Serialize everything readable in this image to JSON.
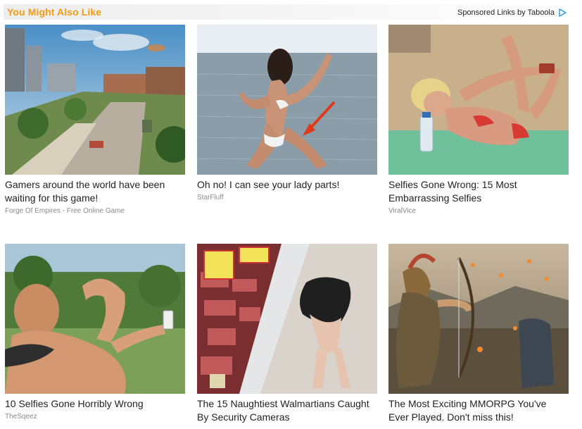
{
  "header": {
    "title": "You Might Also Like",
    "sponsor_label": "Sponsored Links by Taboola",
    "sponsor_icon": "taboola-play-icon"
  },
  "colors": {
    "title_orange": "#f39c12",
    "text": "#222222",
    "source_gray": "#8a8a8a",
    "sponsor_icon_blue": "#3aa7e0"
  },
  "cards": [
    {
      "title": "Gamers around the world have been waiting for this game!",
      "source": "Forge Of Empires - Free Online Game",
      "image": "city-game-scene"
    },
    {
      "title": "Oh no! I can see your lady parts!",
      "source": "StarFluff",
      "image": "beach-runner-photo"
    },
    {
      "title": "Selfies Gone Wrong: 15 Most Embarrassing Selfies",
      "source": "ViralVice",
      "image": "beach-selfie-photo"
    },
    {
      "title": "10 Selfies Gone Horribly Wrong",
      "source": "TheSqeez",
      "image": "outdoor-selfie-photo"
    },
    {
      "title": "The 15 Naughtiest Walmartians Caught By Security Cameras",
      "source": "",
      "image": "store-aisle-photo"
    },
    {
      "title": "The Most Exciting MMORPG You've Ever Played. Don't miss this!",
      "source": "",
      "image": "archer-game-art"
    }
  ]
}
